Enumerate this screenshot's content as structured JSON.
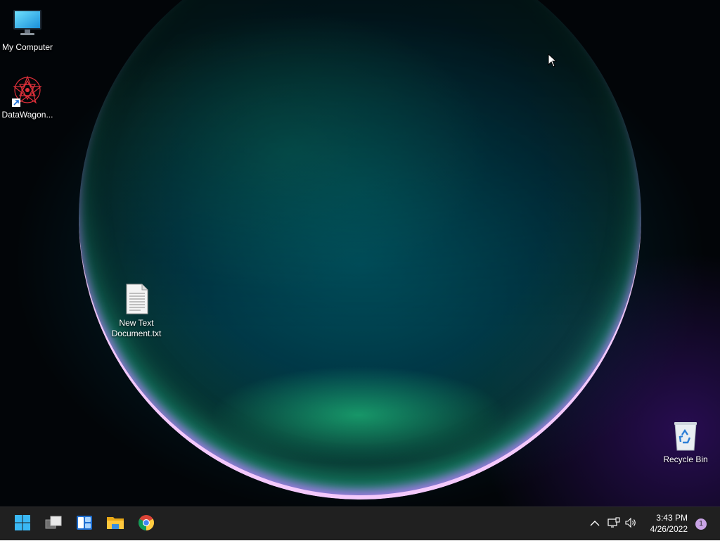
{
  "desktop": {
    "icons": [
      {
        "id": "my-computer",
        "label": "My Computer",
        "icon": "monitor-icon"
      },
      {
        "id": "datawagon",
        "label": "DataWagon...",
        "icon": "datawagon-shortcut-icon"
      },
      {
        "id": "new-text-document",
        "label": "New Text\nDocument.txt",
        "icon": "text-file-icon"
      },
      {
        "id": "recycle-bin",
        "label": "Recycle Bin",
        "icon": "recycle-bin-icon"
      }
    ]
  },
  "taskbar": {
    "apps": [
      {
        "id": "start",
        "icon": "windows-start-icon"
      },
      {
        "id": "task-view",
        "icon": "task-view-icon"
      },
      {
        "id": "widgets",
        "icon": "widgets-icon"
      },
      {
        "id": "file-explorer",
        "icon": "folder-icon"
      },
      {
        "id": "chrome",
        "icon": "chrome-icon"
      }
    ],
    "tray": {
      "time": "3:43 PM",
      "date": "4/26/2022",
      "notification_count": "1"
    }
  },
  "colors": {
    "taskbar_bg": "#202020",
    "start_blue": "#3ab8f5",
    "notification_badge": "#c9a4e6"
  }
}
